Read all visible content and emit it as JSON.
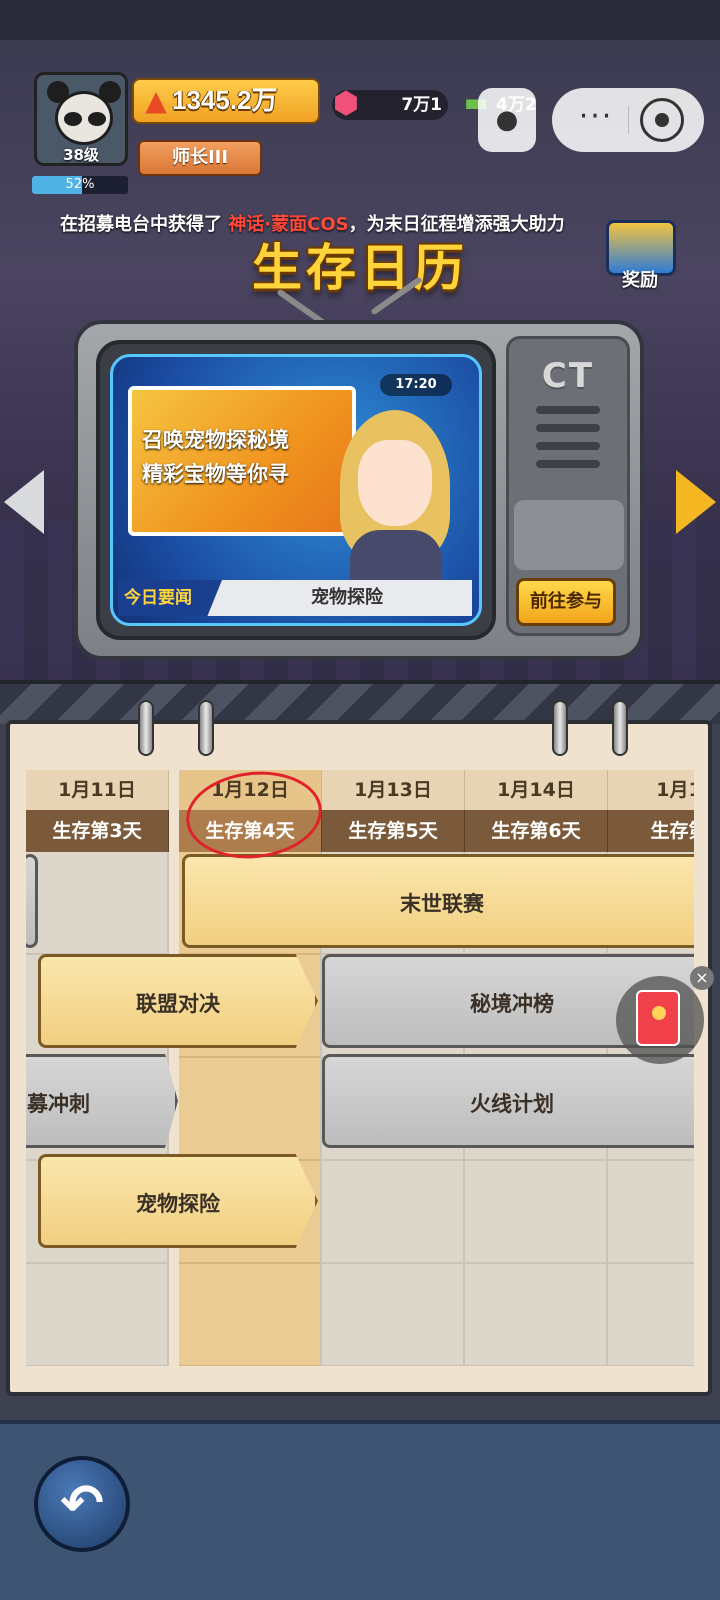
{
  "player": {
    "level": "38级",
    "exp_percent": "52%",
    "exp_fraction": 0.52,
    "power": "1345.2万",
    "rank": "师长III"
  },
  "currency": {
    "gems": "7万1",
    "cash": "4万2"
  },
  "news_ticker": {
    "prefix": "在招募电台中获得了",
    "highlight": "神话·蒙面COS",
    "suffix": "，为末日征程增添强大助力"
  },
  "page_title": "生存日历",
  "reward_label": "奖励",
  "tv": {
    "clock": "17:20",
    "promo_line1": "召唤宠物探秘境",
    "promo_line2": "精彩宝物等你寻",
    "news_tag": "今日要闻",
    "news_title": "宠物探险",
    "brand": "CT",
    "go_button": "前往参与"
  },
  "calendar": {
    "days": [
      {
        "date": "1月11日",
        "day": "生存第3天"
      },
      {
        "date": "1月12日",
        "day": "生存第4天",
        "today": true
      },
      {
        "date": "1月13日",
        "day": "生存第5天"
      },
      {
        "date": "1月14日",
        "day": "生存第6天"
      },
      {
        "date": "1月1",
        "day": "生存第"
      }
    ],
    "events": {
      "doomsday_league": "末世联赛",
      "alliance_duel": "联盟对决",
      "secret_realm_rank": "秘境冲榜",
      "recruit_sprint": "募冲刺",
      "fire_line_plan": "火线计划",
      "pet_adventure": "宠物探险"
    }
  },
  "colors": {
    "accent_gold": "#ffd43a",
    "highlight_red": "#ff4a3a",
    "event_gold": "#f1cf80",
    "event_grey": "#bdbdbd"
  }
}
